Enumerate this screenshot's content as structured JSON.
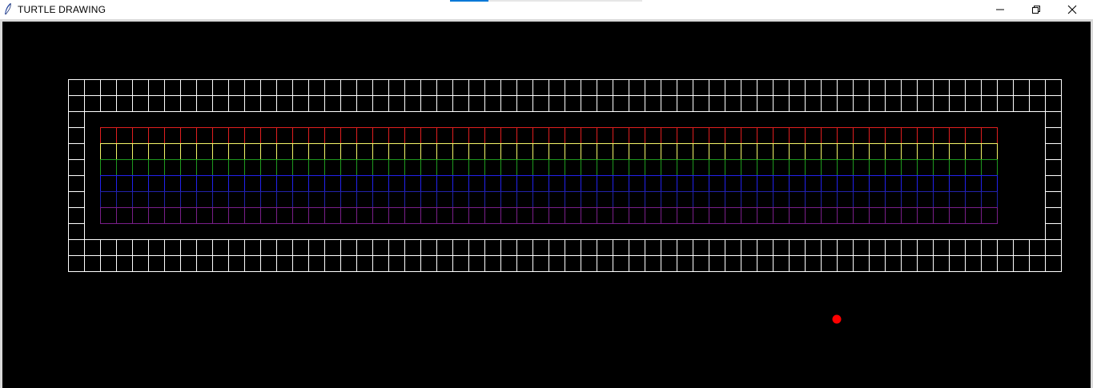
{
  "window": {
    "title": "TURTLE DRAWING",
    "controls": {
      "minimize": "minimize",
      "maximize": "maximize",
      "close": "close"
    }
  },
  "icons": {
    "app": "feather-icon",
    "minimize": "minimize-icon",
    "maximize": "restore-icon",
    "close": "close-icon"
  },
  "colors": {
    "background": "#000000",
    "border_grid": "#ffffff",
    "row_colors": [
      "#e01f1f",
      "#f5f56a",
      "#1f9a1f",
      "#2222ee",
      "#2222aa",
      "#7a1f8a"
    ],
    "turtle_dot": "#ff0000"
  },
  "drawing": {
    "outer_grid": {
      "cols": 62,
      "rows": 12
    },
    "inner_grid": {
      "cols": 56,
      "rows": 6
    }
  }
}
